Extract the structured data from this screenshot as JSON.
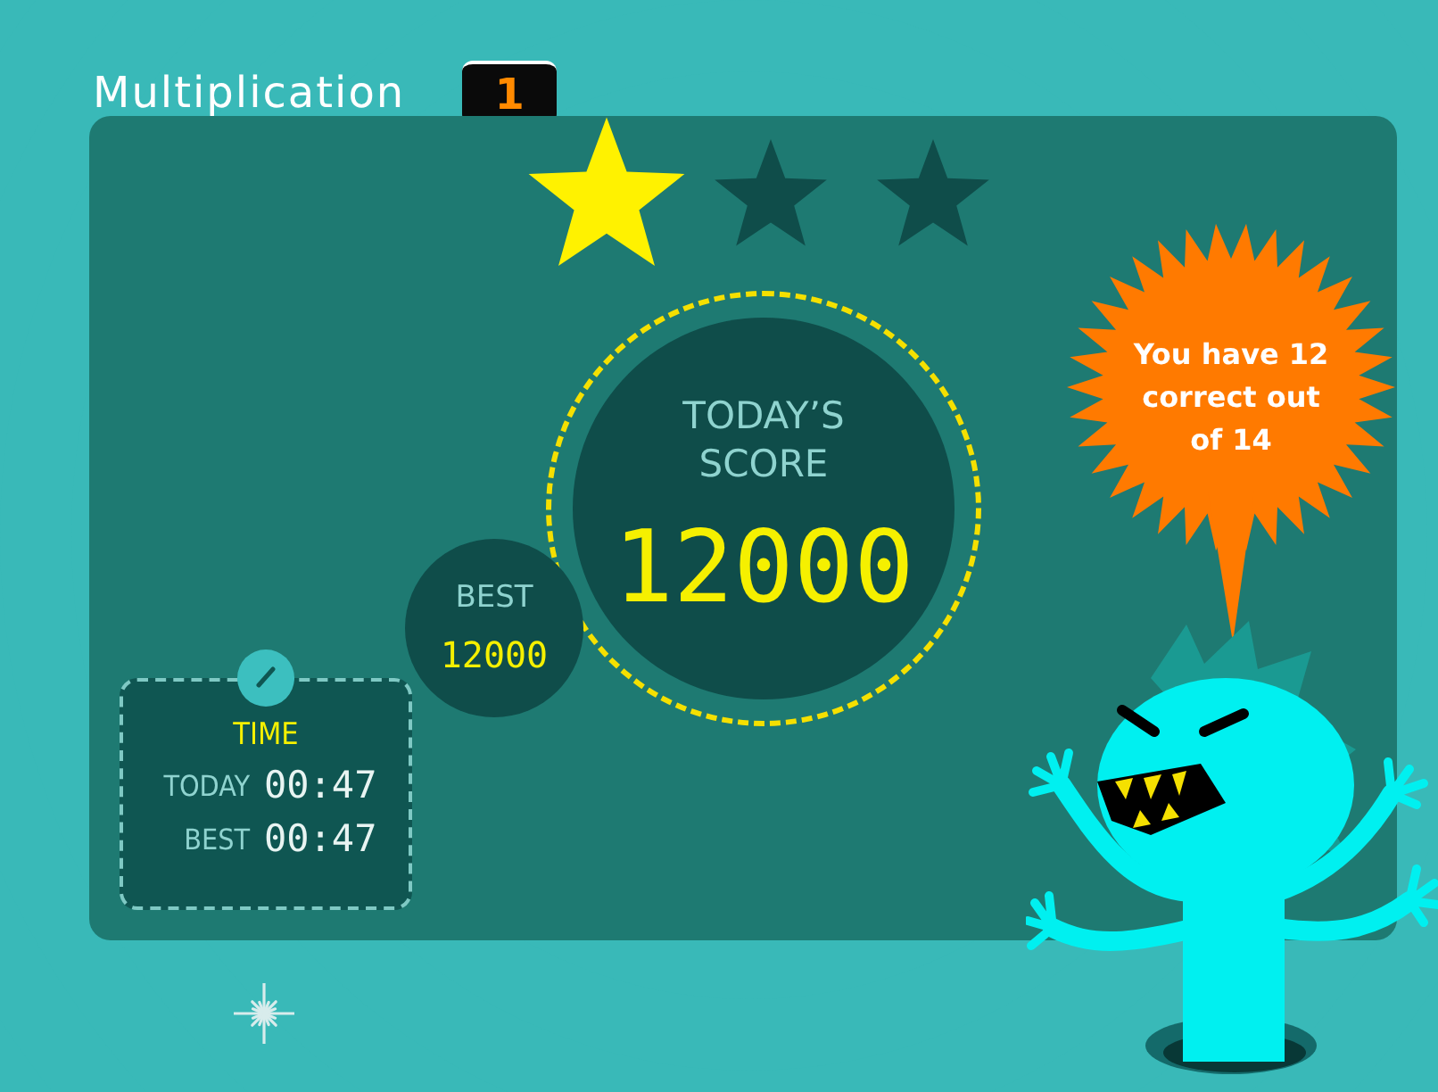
{
  "title": "Multiplication",
  "level_badge": "1",
  "stars": 1,
  "score": {
    "label": "TODAY’S SCORE",
    "value": "12000"
  },
  "best": {
    "label": "BEST",
    "value": "12000"
  },
  "time": {
    "title": "TIME",
    "rows": [
      {
        "label": "TODAY",
        "value": "00:47"
      },
      {
        "label": "BEST",
        "value": "00:47"
      }
    ]
  },
  "speech_bubble": {
    "text": "You have 12 correct out of 14"
  }
}
